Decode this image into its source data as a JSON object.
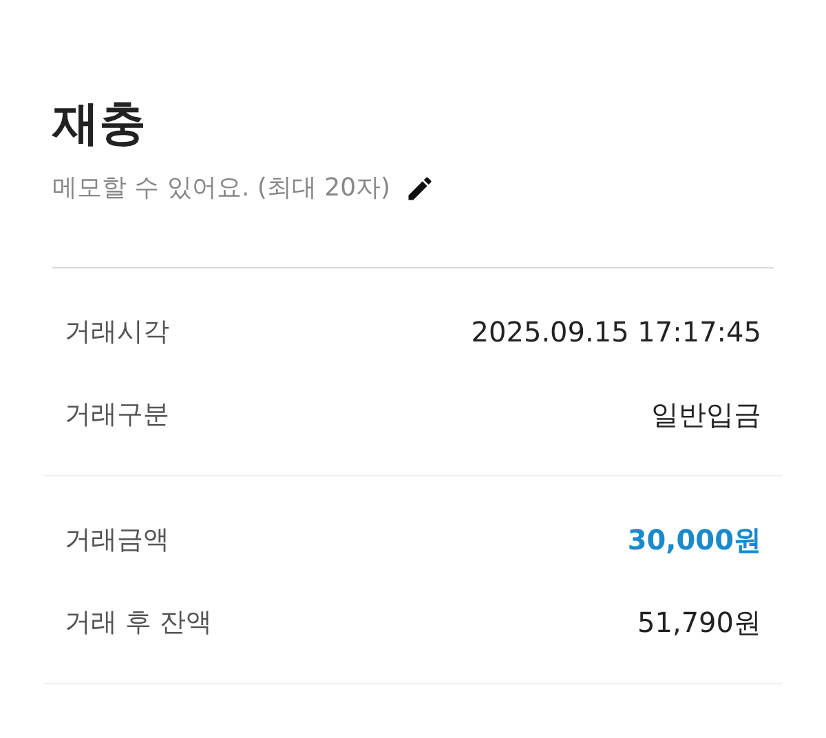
{
  "title": "재충",
  "memo": {
    "placeholder": "메모할 수 있어요. (최대 20자)"
  },
  "sections": [
    {
      "rows": [
        {
          "label": "거래시각",
          "value": "2025.09.15 17:17:45",
          "highlight": false
        },
        {
          "label": "거래구분",
          "value": "일반입금",
          "highlight": false
        }
      ]
    },
    {
      "rows": [
        {
          "label": "거래금액",
          "value": "30,000원",
          "highlight": true
        },
        {
          "label": "거래 후 잔액",
          "value": "51,790원",
          "highlight": false
        }
      ]
    }
  ]
}
